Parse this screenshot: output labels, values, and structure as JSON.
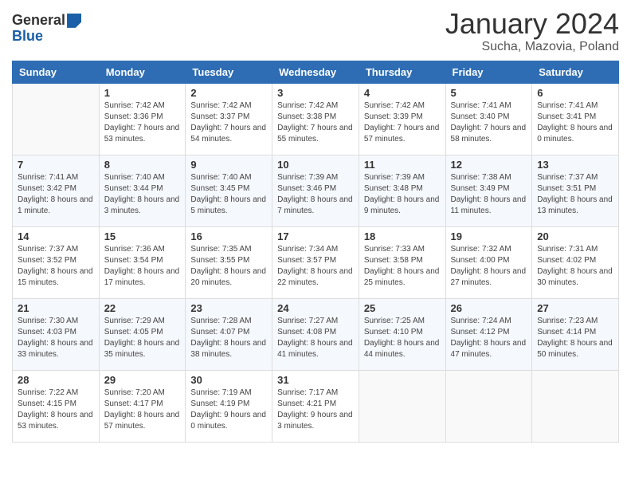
{
  "header": {
    "logo_general": "General",
    "logo_blue": "Blue",
    "title": "January 2024",
    "location": "Sucha, Mazovia, Poland"
  },
  "columns": [
    "Sunday",
    "Monday",
    "Tuesday",
    "Wednesday",
    "Thursday",
    "Friday",
    "Saturday"
  ],
  "weeks": [
    [
      {
        "day": "",
        "sunrise": "",
        "sunset": "",
        "daylight": ""
      },
      {
        "day": "1",
        "sunrise": "Sunrise: 7:42 AM",
        "sunset": "Sunset: 3:36 PM",
        "daylight": "Daylight: 7 hours and 53 minutes."
      },
      {
        "day": "2",
        "sunrise": "Sunrise: 7:42 AM",
        "sunset": "Sunset: 3:37 PM",
        "daylight": "Daylight: 7 hours and 54 minutes."
      },
      {
        "day": "3",
        "sunrise": "Sunrise: 7:42 AM",
        "sunset": "Sunset: 3:38 PM",
        "daylight": "Daylight: 7 hours and 55 minutes."
      },
      {
        "day": "4",
        "sunrise": "Sunrise: 7:42 AM",
        "sunset": "Sunset: 3:39 PM",
        "daylight": "Daylight: 7 hours and 57 minutes."
      },
      {
        "day": "5",
        "sunrise": "Sunrise: 7:41 AM",
        "sunset": "Sunset: 3:40 PM",
        "daylight": "Daylight: 7 hours and 58 minutes."
      },
      {
        "day": "6",
        "sunrise": "Sunrise: 7:41 AM",
        "sunset": "Sunset: 3:41 PM",
        "daylight": "Daylight: 8 hours and 0 minutes."
      }
    ],
    [
      {
        "day": "7",
        "sunrise": "Sunrise: 7:41 AM",
        "sunset": "Sunset: 3:42 PM",
        "daylight": "Daylight: 8 hours and 1 minute."
      },
      {
        "day": "8",
        "sunrise": "Sunrise: 7:40 AM",
        "sunset": "Sunset: 3:44 PM",
        "daylight": "Daylight: 8 hours and 3 minutes."
      },
      {
        "day": "9",
        "sunrise": "Sunrise: 7:40 AM",
        "sunset": "Sunset: 3:45 PM",
        "daylight": "Daylight: 8 hours and 5 minutes."
      },
      {
        "day": "10",
        "sunrise": "Sunrise: 7:39 AM",
        "sunset": "Sunset: 3:46 PM",
        "daylight": "Daylight: 8 hours and 7 minutes."
      },
      {
        "day": "11",
        "sunrise": "Sunrise: 7:39 AM",
        "sunset": "Sunset: 3:48 PM",
        "daylight": "Daylight: 8 hours and 9 minutes."
      },
      {
        "day": "12",
        "sunrise": "Sunrise: 7:38 AM",
        "sunset": "Sunset: 3:49 PM",
        "daylight": "Daylight: 8 hours and 11 minutes."
      },
      {
        "day": "13",
        "sunrise": "Sunrise: 7:37 AM",
        "sunset": "Sunset: 3:51 PM",
        "daylight": "Daylight: 8 hours and 13 minutes."
      }
    ],
    [
      {
        "day": "14",
        "sunrise": "Sunrise: 7:37 AM",
        "sunset": "Sunset: 3:52 PM",
        "daylight": "Daylight: 8 hours and 15 minutes."
      },
      {
        "day": "15",
        "sunrise": "Sunrise: 7:36 AM",
        "sunset": "Sunset: 3:54 PM",
        "daylight": "Daylight: 8 hours and 17 minutes."
      },
      {
        "day": "16",
        "sunrise": "Sunrise: 7:35 AM",
        "sunset": "Sunset: 3:55 PM",
        "daylight": "Daylight: 8 hours and 20 minutes."
      },
      {
        "day": "17",
        "sunrise": "Sunrise: 7:34 AM",
        "sunset": "Sunset: 3:57 PM",
        "daylight": "Daylight: 8 hours and 22 minutes."
      },
      {
        "day": "18",
        "sunrise": "Sunrise: 7:33 AM",
        "sunset": "Sunset: 3:58 PM",
        "daylight": "Daylight: 8 hours and 25 minutes."
      },
      {
        "day": "19",
        "sunrise": "Sunrise: 7:32 AM",
        "sunset": "Sunset: 4:00 PM",
        "daylight": "Daylight: 8 hours and 27 minutes."
      },
      {
        "day": "20",
        "sunrise": "Sunrise: 7:31 AM",
        "sunset": "Sunset: 4:02 PM",
        "daylight": "Daylight: 8 hours and 30 minutes."
      }
    ],
    [
      {
        "day": "21",
        "sunrise": "Sunrise: 7:30 AM",
        "sunset": "Sunset: 4:03 PM",
        "daylight": "Daylight: 8 hours and 33 minutes."
      },
      {
        "day": "22",
        "sunrise": "Sunrise: 7:29 AM",
        "sunset": "Sunset: 4:05 PM",
        "daylight": "Daylight: 8 hours and 35 minutes."
      },
      {
        "day": "23",
        "sunrise": "Sunrise: 7:28 AM",
        "sunset": "Sunset: 4:07 PM",
        "daylight": "Daylight: 8 hours and 38 minutes."
      },
      {
        "day": "24",
        "sunrise": "Sunrise: 7:27 AM",
        "sunset": "Sunset: 4:08 PM",
        "daylight": "Daylight: 8 hours and 41 minutes."
      },
      {
        "day": "25",
        "sunrise": "Sunrise: 7:25 AM",
        "sunset": "Sunset: 4:10 PM",
        "daylight": "Daylight: 8 hours and 44 minutes."
      },
      {
        "day": "26",
        "sunrise": "Sunrise: 7:24 AM",
        "sunset": "Sunset: 4:12 PM",
        "daylight": "Daylight: 8 hours and 47 minutes."
      },
      {
        "day": "27",
        "sunrise": "Sunrise: 7:23 AM",
        "sunset": "Sunset: 4:14 PM",
        "daylight": "Daylight: 8 hours and 50 minutes."
      }
    ],
    [
      {
        "day": "28",
        "sunrise": "Sunrise: 7:22 AM",
        "sunset": "Sunset: 4:15 PM",
        "daylight": "Daylight: 8 hours and 53 minutes."
      },
      {
        "day": "29",
        "sunrise": "Sunrise: 7:20 AM",
        "sunset": "Sunset: 4:17 PM",
        "daylight": "Daylight: 8 hours and 57 minutes."
      },
      {
        "day": "30",
        "sunrise": "Sunrise: 7:19 AM",
        "sunset": "Sunset: 4:19 PM",
        "daylight": "Daylight: 9 hours and 0 minutes."
      },
      {
        "day": "31",
        "sunrise": "Sunrise: 7:17 AM",
        "sunset": "Sunset: 4:21 PM",
        "daylight": "Daylight: 9 hours and 3 minutes."
      },
      {
        "day": "",
        "sunrise": "",
        "sunset": "",
        "daylight": ""
      },
      {
        "day": "",
        "sunrise": "",
        "sunset": "",
        "daylight": ""
      },
      {
        "day": "",
        "sunrise": "",
        "sunset": "",
        "daylight": ""
      }
    ]
  ]
}
